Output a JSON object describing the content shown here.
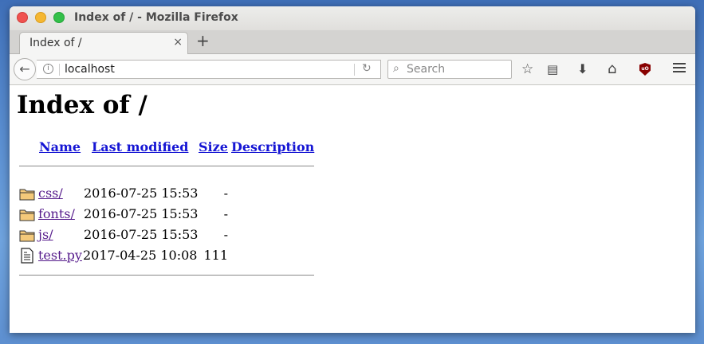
{
  "window": {
    "title": "Index of / - Mozilla Firefox"
  },
  "tabs": [
    {
      "label": "Index of /",
      "close": "×"
    }
  ],
  "new_tab": "+",
  "toolbar": {
    "back_icon": "arrow-left-icon",
    "url": "localhost",
    "search_placeholder": "Search",
    "icons": [
      "star-icon",
      "reading-list-icon",
      "download-icon",
      "home-icon",
      "ublock-icon",
      "menu-icon"
    ]
  },
  "page": {
    "heading": "Index of /",
    "columns": {
      "name": "Name",
      "last_modified": "Last modified",
      "size": "Size",
      "description": "Description"
    },
    "entries": [
      {
        "name": "css/",
        "type": "folder",
        "modified": "2016-07-25 15:53",
        "size": "-"
      },
      {
        "name": "fonts/",
        "type": "folder",
        "modified": "2016-07-25 15:53",
        "size": "-"
      },
      {
        "name": "js/",
        "type": "folder",
        "modified": "2016-07-25 15:53",
        "size": "-"
      },
      {
        "name": "test.py",
        "type": "file",
        "modified": "2017-04-25 10:08",
        "size": "111"
      }
    ]
  },
  "colors": {
    "link": "#1515d4",
    "visited": "#551a8b",
    "desktop": "#4f82c9"
  }
}
